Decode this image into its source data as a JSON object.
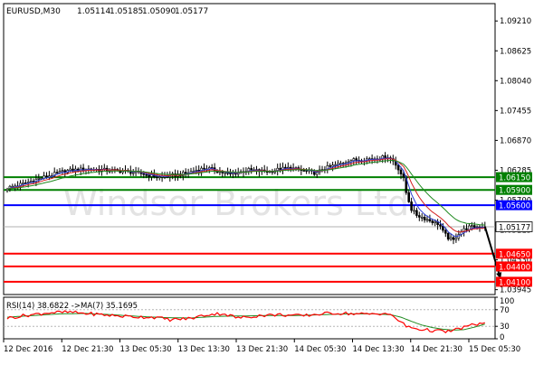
{
  "header": {
    "symbol": "EURUSD,M30",
    "open": "1.05114",
    "high": "1.05185",
    "low": "1.05090",
    "close": "1.05177"
  },
  "watermark": "Windsor Brokers Ltd",
  "colors": {
    "grid_axis": "#000000",
    "candle": "#000000",
    "ma_fast": "#2f3fd6",
    "ma_mid": "#d42020",
    "ma_slow": "#1f8a1f",
    "level_support": "#ff0000",
    "level_resistance": "#008000",
    "level_pivot": "#0000ff",
    "rsi_line": "#ff0000",
    "rsi_ma": "#1f8a1f",
    "arrow": "#000000",
    "watermark": "#e3e3e3"
  },
  "chart_data": [
    {
      "type": "candlestick",
      "symbol": "EURUSD",
      "timeframe": "M30",
      "y_ticks": [
        "1.09210",
        "1.08625",
        "1.08040",
        "1.07455",
        "1.06870",
        "1.06285",
        "1.05700",
        "1.05115",
        "1.04530",
        "1.03945"
      ],
      "ylim": [
        1.0385,
        1.0955
      ],
      "x_ticks": [
        "12 Dec 2016",
        "12 Dec 21:30",
        "13 Dec 05:30",
        "13 Dec 13:30",
        "13 Dec 21:30",
        "14 Dec 05:30",
        "14 Dec 13:30",
        "14 Dec 21:30",
        "15 Dec 05:30"
      ],
      "current_price": "1.05177",
      "levels": [
        {
          "label": "1.06150",
          "value": 1.0615,
          "kind": "resistance"
        },
        {
          "label": "1.05900",
          "value": 1.059,
          "kind": "resistance"
        },
        {
          "label": "1.05600",
          "value": 1.056,
          "kind": "pivot"
        },
        {
          "label": "1.04650",
          "value": 1.0465,
          "kind": "support"
        },
        {
          "label": "1.04400",
          "value": 1.044,
          "kind": "support"
        },
        {
          "label": "1.04100",
          "value": 1.041,
          "kind": "support"
        }
      ],
      "price_path": [
        [
          0,
          1.0594
        ],
        [
          6,
          1.0602
        ],
        [
          12,
          1.0612
        ],
        [
          16,
          1.0618
        ],
        [
          22,
          1.0627
        ],
        [
          30,
          1.0631
        ],
        [
          38,
          1.0629
        ],
        [
          46,
          1.0626
        ],
        [
          52,
          1.0621
        ],
        [
          58,
          1.0615
        ],
        [
          64,
          1.0619
        ],
        [
          68,
          1.0622
        ],
        [
          72,
          1.0629
        ],
        [
          76,
          1.0633
        ],
        [
          80,
          1.0627
        ],
        [
          84,
          1.0621
        ],
        [
          88,
          1.0624
        ],
        [
          92,
          1.0629
        ],
        [
          96,
          1.0627
        ],
        [
          100,
          1.0626
        ],
        [
          104,
          1.0631
        ],
        [
          108,
          1.0633
        ],
        [
          112,
          1.0628
        ],
        [
          116,
          1.0625
        ],
        [
          118,
          1.0622
        ],
        [
          120,
          1.0631
        ],
        [
          124,
          1.0637
        ],
        [
          128,
          1.0643
        ],
        [
          130,
          1.0648
        ],
        [
          134,
          1.0649
        ],
        [
          138,
          1.0651
        ],
        [
          142,
          1.0653
        ],
        [
          145,
          1.0655
        ],
        [
          147,
          1.0647
        ],
        [
          149,
          1.0632
        ],
        [
          151,
          1.0612
        ],
        [
          152,
          1.0585
        ],
        [
          154,
          1.0552
        ],
        [
          156,
          1.0541
        ],
        [
          160,
          1.0532
        ],
        [
          164,
          1.0524
        ],
        [
          165,
          1.0519
        ],
        [
          166,
          1.0508
        ],
        [
          168,
          1.0496
        ],
        [
          170,
          1.0491
        ],
        [
          172,
          1.0505
        ],
        [
          174,
          1.0512
        ],
        [
          176,
          1.0517
        ],
        [
          180,
          1.0518
        ],
        [
          182,
          1.0519
        ]
      ],
      "moving_averages": [
        {
          "color": "ma_fast",
          "period": 5
        },
        {
          "color": "ma_mid",
          "period": 10
        },
        {
          "color": "ma_slow",
          "period": 20
        }
      ],
      "forecast_arrow": {
        "from": [
          182,
          1.0518
        ],
        "to": [
          188,
          1.0415
        ]
      }
    },
    {
      "type": "line",
      "indicator": "RSI",
      "label": "RSI(14) 38.6822 ->MA(7) 35.1695",
      "rsi_value": "38.6822",
      "ma_value": "35.1695",
      "y_ticks": [
        "100",
        "70",
        "30",
        "0"
      ],
      "ylim": [
        0,
        100
      ],
      "levels": [
        70,
        30
      ],
      "rsi_path": [
        [
          0,
          50
        ],
        [
          8,
          57
        ],
        [
          16,
          63
        ],
        [
          24,
          64
        ],
        [
          32,
          60
        ],
        [
          40,
          56
        ],
        [
          48,
          53
        ],
        [
          56,
          52
        ],
        [
          62,
          46
        ],
        [
          70,
          49
        ],
        [
          76,
          58
        ],
        [
          82,
          61
        ],
        [
          88,
          50
        ],
        [
          96,
          56
        ],
        [
          104,
          58
        ],
        [
          112,
          55
        ],
        [
          118,
          59
        ],
        [
          124,
          62
        ],
        [
          130,
          61
        ],
        [
          136,
          59
        ],
        [
          140,
          60
        ],
        [
          144,
          62
        ],
        [
          148,
          50
        ],
        [
          152,
          30
        ],
        [
          156,
          24
        ],
        [
          160,
          21
        ],
        [
          164,
          19
        ],
        [
          167,
          17
        ],
        [
          170,
          20
        ],
        [
          174,
          28
        ],
        [
          178,
          34
        ],
        [
          182,
          38.6822
        ]
      ],
      "ma_path": [
        [
          0,
          52
        ],
        [
          10,
          56
        ],
        [
          20,
          60
        ],
        [
          30,
          61
        ],
        [
          40,
          58
        ],
        [
          50,
          54
        ],
        [
          60,
          51
        ],
        [
          70,
          50
        ],
        [
          80,
          54
        ],
        [
          90,
          55
        ],
        [
          100,
          56
        ],
        [
          110,
          56
        ],
        [
          120,
          58
        ],
        [
          130,
          60
        ],
        [
          140,
          60
        ],
        [
          146,
          58
        ],
        [
          150,
          52
        ],
        [
          154,
          42
        ],
        [
          158,
          33
        ],
        [
          162,
          27
        ],
        [
          166,
          23
        ],
        [
          170,
          21
        ],
        [
          174,
          22
        ],
        [
          178,
          28
        ],
        [
          182,
          35.1695
        ]
      ]
    }
  ]
}
